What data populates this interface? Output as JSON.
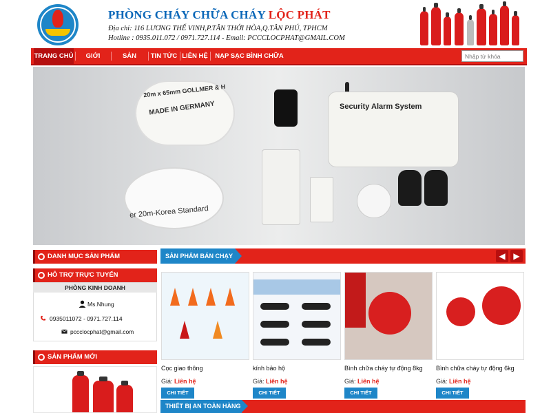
{
  "header": {
    "company_part1": "PHÒNG CHÁY CHỮA CHÁY ",
    "company_part2": "LỘC PHÁT",
    "address": "Địa chỉ: 116 LƯƠNG THẾ VINH,P.TÂN THỚI HÒA,Q.TÂN PHÚ, TPHCM",
    "hotline": "Hotline : 0935.011.072 / 0971.727.114  -  Email: PCCCLOCPHAT@GMAIL.COM"
  },
  "nav": {
    "items": [
      {
        "label": "TRANG CHỦ"
      },
      {
        "label": "GIỚI THIỆU"
      },
      {
        "label": "SẢN PHẨM"
      },
      {
        "label": "TIN TỨC"
      },
      {
        "label": "LIÊN HỆ"
      },
      {
        "label": "NẠP SẠC BÌNH CHỮA CHÁY"
      }
    ],
    "search_placeholder": "Nhập từ khóa"
  },
  "banner": {
    "hose1_text": "MADE IN GERMANY",
    "hose1_text2": "20m x 65mm  GOLLMER & H",
    "hose2_text": "er 20m-Korea Standard",
    "alarm_label": "Security Alarm System"
  },
  "sidebar": {
    "categories_title": "DANH MỤC SẢN PHẨM",
    "support_title": "HỖ TRỢ TRỰC TUYẾN",
    "department": "PHÒNG KINH DOANH",
    "contact_name": "Ms.Nhung",
    "phones": "0935011072 - 0971.727.114",
    "email": "pccclocphat@gmail.com",
    "new_products_title": "SẢN PHẨM MỚI"
  },
  "main": {
    "bestsellers_title": "SẢN PHẨM BÁN CHẠY",
    "marine_title": "THIẾT BỊ AN TOÀN HÀNG HẢI",
    "prev_label": "◀",
    "next_label": "▶",
    "products": [
      {
        "name": "Cọc giao thông",
        "price_label": "Giá: ",
        "price": "Liên hệ",
        "button": "CHI TIẾT"
      },
      {
        "name": "kính bảo hộ",
        "price_label": "Giá: ",
        "price": "Liên hệ",
        "button": "CHI TIẾT"
      },
      {
        "name": "Bình chữa cháy tự động 8kg",
        "price_label": "Giá: ",
        "price": "Liên hệ",
        "button": "CHI TIẾT"
      },
      {
        "name": "Bình chữa cháy tự động 6kg",
        "price_label": "Giá: ",
        "price": "Liên hệ",
        "button": "CHI TIẾT"
      }
    ]
  },
  "colors": {
    "brand_red": "#e2231a",
    "brand_blue": "#1e86c8",
    "nav_active": "#b50f0f"
  }
}
